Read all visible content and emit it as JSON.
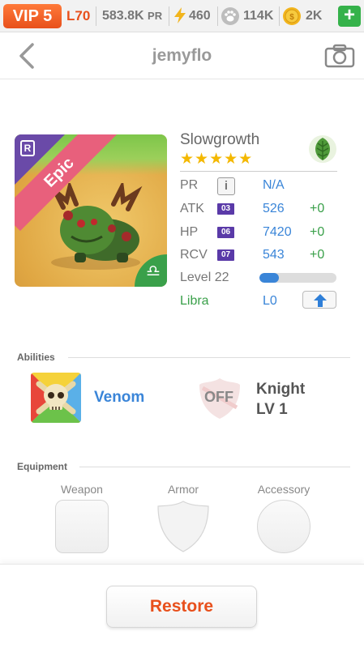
{
  "topbar": {
    "vip": "VIP 5",
    "level": "L70",
    "pr": "583.8K",
    "pr_unit": "PR",
    "energy": "460",
    "food": "114K",
    "coins": "2K",
    "add": "+",
    "icons": [
      "lightning-icon",
      "paw-icon",
      "coin-icon"
    ]
  },
  "nav": {
    "title": "jemyflo",
    "back_icon": "chevron-left-icon",
    "camera_icon": "camera-icon"
  },
  "monster": {
    "name": "Slowgrowth",
    "stars": "★★★★★",
    "rarity": "Epic",
    "rarity_badge": "R",
    "zodiac_glyph": "♎",
    "element_icon": "leaf-icon",
    "stats": [
      {
        "label": "PR",
        "value": "N/A",
        "bonus": ""
      },
      {
        "label": "ATK",
        "badge": "03",
        "value": "526",
        "bonus": "+0"
      },
      {
        "label": "HP",
        "badge": "06",
        "value": "7420",
        "bonus": "+0"
      },
      {
        "label": "RCV",
        "badge": "07",
        "value": "543",
        "bonus": "+0"
      }
    ],
    "info_icon": "i",
    "level_label": "Level 22",
    "level_progress": 0.25,
    "zodiac_name": "Libra",
    "zodiac_level": "L0"
  },
  "abilities": {
    "label": "Abilities",
    "primary": {
      "name": "Venom",
      "icon": "skull-icon"
    },
    "secondary": {
      "state": "OFF",
      "name": "Knight",
      "level": "LV 1",
      "icon": "shield-icon"
    }
  },
  "equipment": {
    "label": "Equipment",
    "slots": [
      "Weapon",
      "Armor",
      "Accessory"
    ]
  },
  "footer": {
    "restore": "Restore"
  },
  "colors": {
    "accent": "#e8501c",
    "blue": "#3a85d8",
    "green": "#3aa04a",
    "purple": "#5a3aa8"
  }
}
